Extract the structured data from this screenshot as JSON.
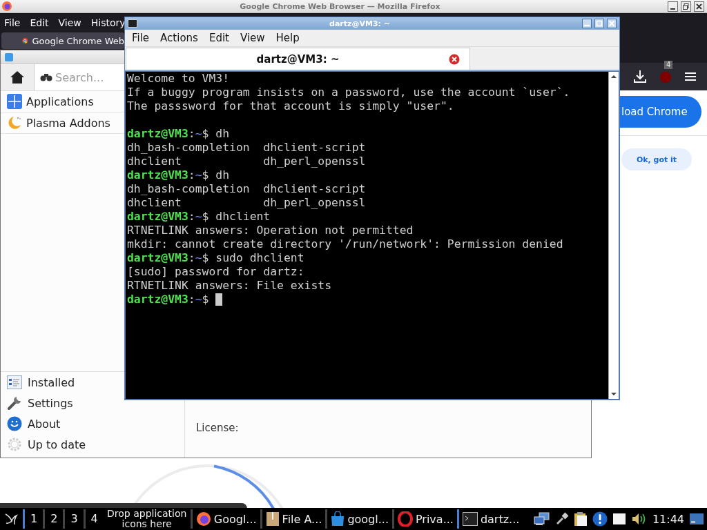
{
  "firefox": {
    "title": "Google Chrome Web Browser — Mozilla Firefox",
    "menu": [
      "File",
      "Edit",
      "View",
      "History"
    ],
    "tab": "Google Chrome Web",
    "addon_badge": "4",
    "download_button": "load Chrome",
    "ok_button": "Ok, got it"
  },
  "discover": {
    "search": {
      "placeholder": "Search..."
    },
    "top_items": [
      {
        "label": "Applications",
        "kind": "apps"
      },
      {
        "label": "Plasma Addons",
        "kind": "plasma"
      }
    ],
    "bottom_items": [
      {
        "label": "Installed",
        "kind": "installed"
      },
      {
        "label": "Settings",
        "kind": "settings"
      },
      {
        "label": "About",
        "kind": "about"
      },
      {
        "label": "Up to date",
        "kind": "uptodate"
      }
    ],
    "license_label": "License:"
  },
  "terminal": {
    "title": "dartz@VM3: ~",
    "menu": [
      "File",
      "Actions",
      "Edit",
      "View",
      "Help"
    ],
    "tab": "dartz@VM3: ~",
    "lines": [
      {
        "kind": "text",
        "text": "Welcome to VM3!"
      },
      {
        "kind": "text",
        "text": "If a buggy program insists on a password, use the account `user`."
      },
      {
        "kind": "text",
        "text": "The passsword for that account is simply \"user\"."
      },
      {
        "kind": "blank"
      },
      {
        "kind": "prompt",
        "user": "dartz@VM3",
        "separator": ":",
        "path": "~",
        "sign": "$",
        "command": "dh"
      },
      {
        "kind": "text",
        "text": "dh_bash-completion  dhclient-script"
      },
      {
        "kind": "text",
        "text": "dhclient            dh_perl_openssl"
      },
      {
        "kind": "prompt",
        "user": "dartz@VM3",
        "separator": ":",
        "path": "~",
        "sign": "$",
        "command": "dh"
      },
      {
        "kind": "text",
        "text": "dh_bash-completion  dhclient-script"
      },
      {
        "kind": "text",
        "text": "dhclient            dh_perl_openssl"
      },
      {
        "kind": "prompt",
        "user": "dartz@VM3",
        "separator": ":",
        "path": "~",
        "sign": "$",
        "command": "dhclient"
      },
      {
        "kind": "text",
        "text": "RTNETLINK answers: Operation not permitted"
      },
      {
        "kind": "text",
        "text": "mkdir: cannot create directory '/run/network': Permission denied"
      },
      {
        "kind": "prompt",
        "user": "dartz@VM3",
        "separator": ":",
        "path": "~",
        "sign": "$",
        "command": "sudo dhclient"
      },
      {
        "kind": "text",
        "text": "[sudo] password for dartz:"
      },
      {
        "kind": "text",
        "text": "RTNETLINK answers: File exists"
      },
      {
        "kind": "cursor",
        "user": "dartz@VM3",
        "separator": ":",
        "path": "~",
        "sign": "$"
      }
    ]
  },
  "taskbar": {
    "workspaces": [
      {
        "label": "1",
        "selected": true
      },
      {
        "label": "2",
        "selected": false
      },
      {
        "label": "3",
        "selected": false
      },
      {
        "label": "4",
        "selected": false
      }
    ],
    "launcher_hint": "Drop application icons here",
    "tasks": [
      {
        "label": "Googl...",
        "kind": "firefox",
        "selected": false
      },
      {
        "label": "File A...",
        "kind": "archive",
        "selected": false
      },
      {
        "label": "googl...",
        "kind": "store",
        "selected": false
      },
      {
        "label": "Priva...",
        "kind": "opera",
        "selected": false
      },
      {
        "label": "dartz...",
        "kind": "terminal",
        "selected": true
      }
    ],
    "clock": "11:44"
  }
}
